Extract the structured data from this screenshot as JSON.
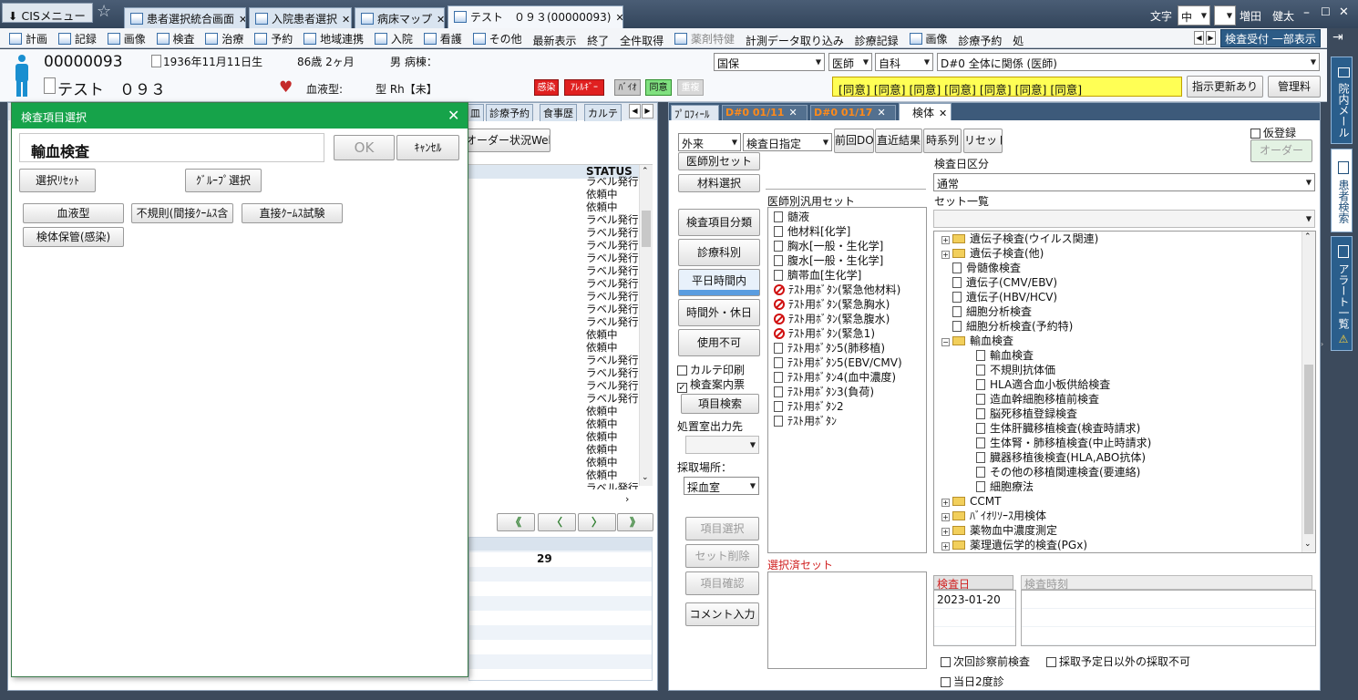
{
  "titlebar": {
    "cis_menu": "CISメニュー",
    "tabs": [
      "患者選択統合画面",
      "入院患者選択",
      "病床マップ",
      "テスト　０９３(00000093)"
    ],
    "font_label": "文字",
    "font_size": "中",
    "user": "増田　健太"
  },
  "menu": {
    "items": [
      "計画",
      "記録",
      "画像",
      "検査",
      "治療",
      "予約",
      "地域連携",
      "入院",
      "看護",
      "その他",
      "最新表示",
      "終了",
      "全件取得",
      "薬剤特健",
      "計測データ取り込み",
      "診療記録",
      "画像",
      "診療予約",
      "処"
    ],
    "right_button": "検査受付 一部表示"
  },
  "patient": {
    "id": "00000093",
    "name": "テスト　０９３",
    "dob": "1936年11月11日生",
    "age": "86歳 2ヶ月",
    "sex_ward": "男 病棟：",
    "blood_label": "血液型:",
    "blood_value": "型 Rh【未】",
    "badges": [
      "感染",
      "ｱﾚﾙｷﾞｰ",
      "ﾊﾞｲｵ",
      "同意",
      "重複"
    ],
    "insurance": "国保",
    "doctor": "医師",
    "dept": "自科",
    "diagnosis": "D#0 全体に関係 (医師)",
    "consent_bar": "[同意] [同意] [同意] [同意] [同意] [同意] [同意]",
    "instruction_btn": "指示更新あり",
    "manage_btn": "管理料"
  },
  "left_tabs": [
    "皿",
    "診療予約",
    "食事歴",
    "カルテ"
  ],
  "middle": {
    "order_btn": "オーダー状況Web",
    "status_header": "STATUS",
    "statuses": [
      "ラベル発行",
      "依頼中",
      "依頼中",
      "ラベル発行",
      "ラベル発行",
      "ラベル発行",
      "ラベル発行",
      "ラベル発行",
      "ラベル発行",
      "ラベル発行",
      "ラベル発行",
      "ラベル発行",
      "依頼中",
      "依頼中",
      "ラベル発行",
      "ラベル発行",
      "ラベル発行",
      "ラベル発行",
      "依頼中",
      "依頼中",
      "依頼中",
      "依頼中",
      "依頼中",
      "依頼中",
      "ラベル発行"
    ],
    "nav_buttons": [
      "《",
      "〈",
      "〉",
      "》"
    ],
    "count": "29"
  },
  "dialog": {
    "title": "検査項目選択",
    "field_value": "輸血検査",
    "ok": "OK",
    "cancel": "ｷｬﾝｾﾙ",
    "reset": "選択ﾘｾｯﾄ",
    "group": "ｸﾞﾙｰﾌﾟ選択",
    "items": [
      "血液型",
      "不規則(間接ｸｰﾑｽ含",
      "直接ｸｰﾑｽ試験",
      "検体保管(感染)"
    ]
  },
  "right_tabs": [
    "ﾌﾟﾛﾌｨｰﾙ",
    "D#0 01/11",
    "D#0 01/17",
    "検体"
  ],
  "right": {
    "outpatient": "外来",
    "date_mode": "検査日指定",
    "buttons_top": [
      "前回DO",
      "直近結果",
      "時系列",
      "リセット"
    ],
    "provisional": "仮登録",
    "order_btn": "オーダー",
    "doctor_set": "医師別セット",
    "material_sel": "材料選択",
    "category_btns": [
      "検査項目分類",
      "診療科別",
      "平日時間内",
      "時間外・休日",
      "使用不可"
    ],
    "chart_print": "カルテ印刷",
    "guide_ticket": "検査案内票",
    "item_search": "項目検索",
    "treatment_out": "処置室出力先",
    "collection_label": "採取場所：",
    "collection_value": "採血室",
    "action_btns": [
      "項目選択",
      "セット削除",
      "項目確認",
      "コメント入力"
    ],
    "general_set_label": "医師別汎用セット",
    "general_sets": [
      {
        "icon": "doc",
        "label": "髄液"
      },
      {
        "icon": "doc",
        "label": "他材料[化学]"
      },
      {
        "icon": "doc",
        "label": "胸水[一般・生化学]"
      },
      {
        "icon": "doc",
        "label": "腹水[一般・生化学]"
      },
      {
        "icon": "doc",
        "label": "臍帯血[生化学]"
      },
      {
        "icon": "no",
        "label": "ﾃｽﾄ用ﾎﾞﾀﾝ(緊急他材料)"
      },
      {
        "icon": "no",
        "label": "ﾃｽﾄ用ﾎﾞﾀﾝ(緊急胸水)"
      },
      {
        "icon": "no",
        "label": "ﾃｽﾄ用ﾎﾞﾀﾝ(緊急腹水)"
      },
      {
        "icon": "no",
        "label": "ﾃｽﾄ用ﾎﾞﾀﾝ(緊急1)"
      },
      {
        "icon": "doc",
        "label": "ﾃｽﾄ用ﾎﾞﾀﾝ5(肺移植)"
      },
      {
        "icon": "doc",
        "label": "ﾃｽﾄ用ﾎﾞﾀﾝ5(EBV/CMV)"
      },
      {
        "icon": "doc",
        "label": "ﾃｽﾄ用ﾎﾞﾀﾝ4(血中濃度)"
      },
      {
        "icon": "doc",
        "label": "ﾃｽﾄ用ﾎﾞﾀﾝ3(負荷)"
      },
      {
        "icon": "doc",
        "label": "ﾃｽﾄ用ﾎﾞﾀﾝ2"
      },
      {
        "icon": "doc",
        "label": "ﾃｽﾄ用ﾎﾞﾀﾝ"
      }
    ],
    "selected_set_label": "選択済セット",
    "exam_day_label": "検査日区分",
    "exam_day_value": "通常",
    "set_list_label": "セット一覧",
    "tree": [
      {
        "lvl": 0,
        "type": "folder",
        "exp": "+",
        "label": "遺伝子検査(ウイルス関連)"
      },
      {
        "lvl": 0,
        "type": "folder",
        "exp": "+",
        "label": "遺伝子検査(他)"
      },
      {
        "lvl": 0,
        "type": "doc",
        "exp": "",
        "label": "骨髄像検査"
      },
      {
        "lvl": 0,
        "type": "doc",
        "exp": "",
        "label": "遺伝子(CMV/EBV)"
      },
      {
        "lvl": 0,
        "type": "doc",
        "exp": "",
        "label": "遺伝子(HBV/HCV)"
      },
      {
        "lvl": 0,
        "type": "doc",
        "exp": "",
        "label": "細胞分析検査"
      },
      {
        "lvl": 0,
        "type": "doc",
        "exp": "",
        "label": "細胞分析検査(予約特)"
      },
      {
        "lvl": 0,
        "type": "folder",
        "exp": "-",
        "label": "輸血検査"
      },
      {
        "lvl": 1,
        "type": "doc",
        "exp": "",
        "label": "輸血検査"
      },
      {
        "lvl": 1,
        "type": "doc",
        "exp": "",
        "label": "不規則抗体価"
      },
      {
        "lvl": 1,
        "type": "doc",
        "exp": "",
        "label": "HLA適合血小板供給検査"
      },
      {
        "lvl": 1,
        "type": "doc",
        "exp": "",
        "label": "造血幹細胞移植前検査"
      },
      {
        "lvl": 1,
        "type": "doc",
        "exp": "",
        "label": "脳死移植登録検査"
      },
      {
        "lvl": 1,
        "type": "doc",
        "exp": "",
        "label": "生体肝臓移植検査(検査時請求)"
      },
      {
        "lvl": 1,
        "type": "doc",
        "exp": "",
        "label": "生体腎・肺移植検査(中止時請求)"
      },
      {
        "lvl": 1,
        "type": "doc",
        "exp": "",
        "label": "臓器移植後検査(HLA,ABO抗体)"
      },
      {
        "lvl": 1,
        "type": "doc",
        "exp": "",
        "label": "その他の移植関連検査(要連絡)"
      },
      {
        "lvl": 1,
        "type": "doc",
        "exp": "",
        "label": "細胞療法"
      },
      {
        "lvl": 0,
        "type": "folder",
        "exp": "+",
        "label": "CCMT"
      },
      {
        "lvl": 0,
        "type": "folder",
        "exp": "+",
        "label": "ﾊﾞｲｵﾘｿｰｽ用検体"
      },
      {
        "lvl": 0,
        "type": "folder",
        "exp": "+",
        "label": "薬物血中濃度測定"
      },
      {
        "lvl": 0,
        "type": "folder",
        "exp": "+",
        "label": "薬理遺伝学的検査(PGx)"
      }
    ],
    "exam_date_label": "検査日",
    "exam_date_value": "2023-01-20",
    "exam_time_label": "検査時刻",
    "next_visit": "次回診察前検査",
    "no_other_day": "採取予定日以外の採取不可",
    "same_day": "当日2度診"
  },
  "side": [
    "院内メール",
    "患者検索",
    "アラート一覧"
  ]
}
